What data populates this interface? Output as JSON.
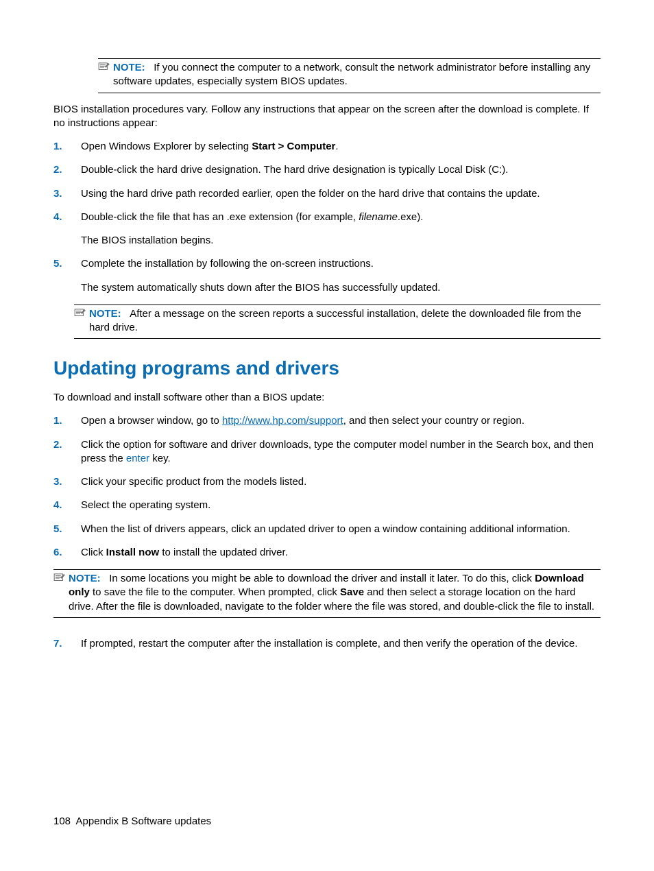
{
  "note1": {
    "label": "NOTE:",
    "text_a": "If you connect the computer to a network, consult the network administrator before installing any software updates, especially system BIOS updates."
  },
  "intro": "BIOS installation procedures vary. Follow any instructions that appear on the screen after the download is complete. If no instructions appear:",
  "steps1": {
    "s1_a": "Open Windows Explorer by selecting ",
    "s1_b": "Start > Computer",
    "s1_c": ".",
    "s2": "Double-click the hard drive designation. The hard drive designation is typically Local Disk (C:).",
    "s3": "Using the hard drive path recorded earlier, open the folder on the hard drive that contains the update.",
    "s4_a": "Double-click the file that has an .exe extension (for example, ",
    "s4_b": "filename",
    "s4_c": ".exe).",
    "s4_sub": "The BIOS installation begins.",
    "s5": "Complete the installation by following the on-screen instructions.",
    "s5_sub": "The system automatically shuts down after the BIOS has successfully updated."
  },
  "note2": {
    "label": "NOTE:",
    "text": "After a message on the screen reports a successful installation, delete the downloaded file from the hard drive."
  },
  "heading": "Updating programs and drivers",
  "intro2": "To download and install software other than a BIOS update:",
  "steps2": {
    "s1_a": "Open a browser window, go to ",
    "s1_link": "http://www.hp.com/support",
    "s1_b": ", and then select your country or region.",
    "s2_a": "Click the option for software and driver downloads, type the computer model number in the Search box, and then press the ",
    "s2_key": "enter",
    "s2_b": " key.",
    "s3": "Click your specific product from the models listed.",
    "s4": "Select the operating system.",
    "s5": "When the list of drivers appears, click an updated driver to open a window containing additional information.",
    "s6_a": "Click ",
    "s6_b": "Install now",
    "s6_c": " to install the updated driver.",
    "note3_label": "NOTE:",
    "note3_a": "In some locations you might be able to download the driver and install it later. To do this, click ",
    "note3_b": "Download only",
    "note3_c": " to save the file to the computer. When prompted, click ",
    "note3_d": "Save",
    "note3_e": " and then select a storage location on the hard drive. After the file is downloaded, navigate to the folder where the file was stored, and double-click the file to install.",
    "s7": "If prompted, restart the computer after the installation is complete, and then verify the operation of the device."
  },
  "nums": {
    "n1": "1.",
    "n2": "2.",
    "n3": "3.",
    "n4": "4.",
    "n5": "5.",
    "n6": "6.",
    "n7": "7."
  },
  "footer": {
    "page": "108",
    "section": "Appendix B   Software updates"
  }
}
